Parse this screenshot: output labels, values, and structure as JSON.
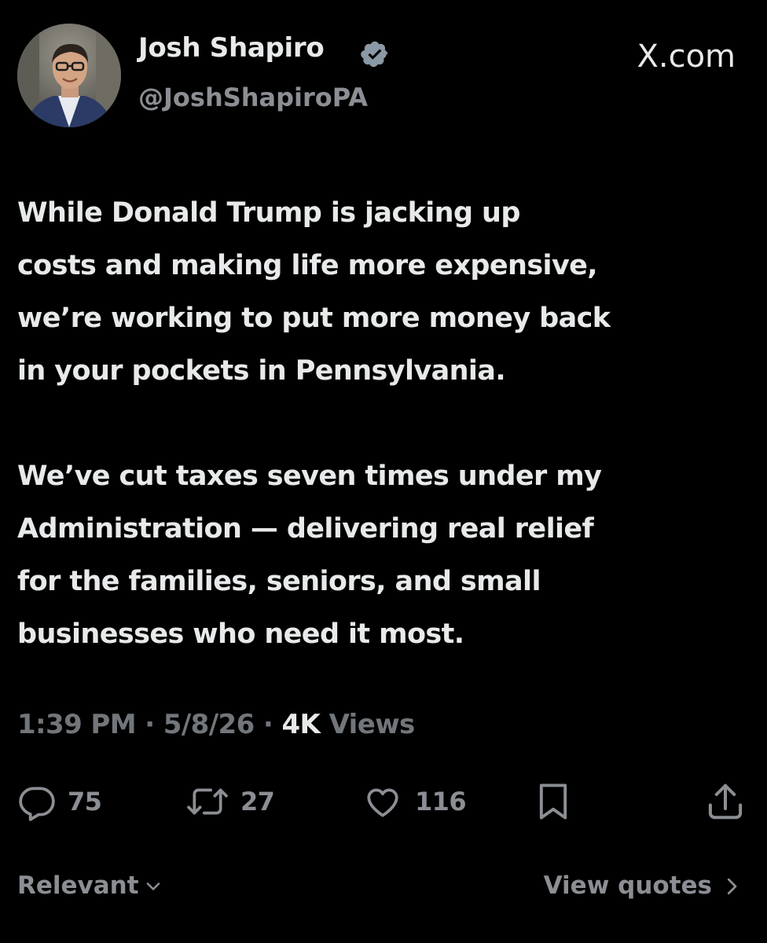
{
  "author": {
    "display_name": "Josh Shapiro",
    "handle": "@JoshShapiroPA",
    "verified": true,
    "avatar_icon": "profile-photo"
  },
  "brand": {
    "label": "X.com"
  },
  "tweet": {
    "paragraphs": [
      {
        "lines": [
          "While Donald Trump is jacking up",
          "costs and making life more expensive,",
          "we’re working to put more money back",
          "in your pockets in Pennsylvania."
        ]
      },
      {
        "lines": [
          "We’ve cut taxes seven times under my",
          "Administration — delivering real relief",
          "for the families, seniors, and small",
          "businesses who need it most."
        ]
      }
    ]
  },
  "meta": {
    "time": "1:39 PM",
    "date": "5/8/26",
    "separator": "·",
    "views_count": "4K",
    "views_label": "Views"
  },
  "actions": {
    "replies": {
      "icon": "reply-icon",
      "count": "75"
    },
    "reposts": {
      "icon": "repost-icon",
      "count": "27"
    },
    "likes": {
      "icon": "heart-icon",
      "count": "116"
    },
    "bookmark": {
      "icon": "bookmark-icon"
    },
    "share": {
      "icon": "share-icon"
    }
  },
  "footer": {
    "sort_label": "Relevant",
    "sort_icon": "chevron-down-icon",
    "quotes_label": "View quotes",
    "quotes_icon": "chevron-right-icon"
  },
  "colors": {
    "background": "#000000",
    "primary_text": "#e7e9ea",
    "secondary_text": "#71767b",
    "icon_gray": "#8b8f94"
  }
}
